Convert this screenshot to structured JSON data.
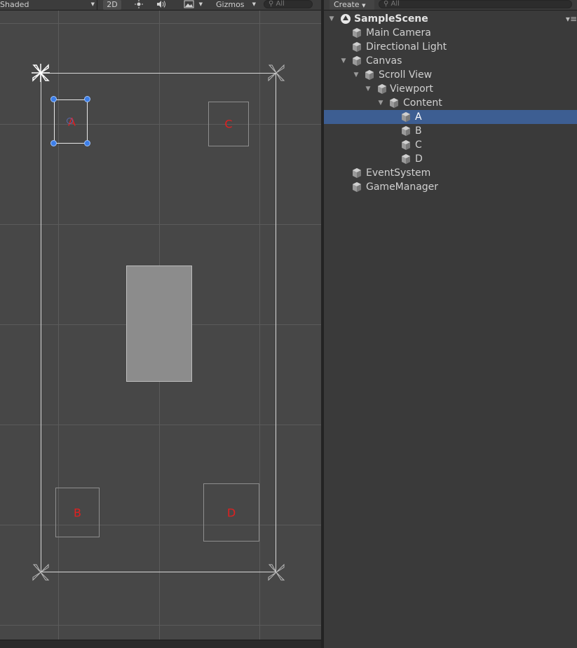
{
  "scene_toolbar": {
    "shading_mode": "Shaded",
    "toggle_2d": "2D",
    "gizmos_label": "Gizmos",
    "search_placeholder": "All",
    "icons": [
      "lighting-icon",
      "audio-icon",
      "effects-icon"
    ]
  },
  "scene_objects": {
    "boxes": [
      {
        "id": "A",
        "label": "A"
      },
      {
        "id": "B",
        "label": "B"
      },
      {
        "id": "C",
        "label": "C"
      },
      {
        "id": "D",
        "label": "D"
      }
    ],
    "colors": {
      "label_red": "#e02020",
      "handle_blue": "#3c7ee8",
      "selection_blue": "#3d5e92"
    }
  },
  "hierarchy": {
    "create_label": "Create",
    "search_placeholder": "All",
    "scene_name": "SampleScene",
    "items": [
      {
        "label": "Main Camera"
      },
      {
        "label": "Directional Light"
      },
      {
        "label": "Canvas"
      },
      {
        "label": "Scroll View"
      },
      {
        "label": "Viewport"
      },
      {
        "label": "Content"
      },
      {
        "label": "A",
        "selected": true
      },
      {
        "label": "B"
      },
      {
        "label": "C"
      },
      {
        "label": "D"
      },
      {
        "label": "EventSystem"
      },
      {
        "label": "GameManager"
      }
    ]
  }
}
